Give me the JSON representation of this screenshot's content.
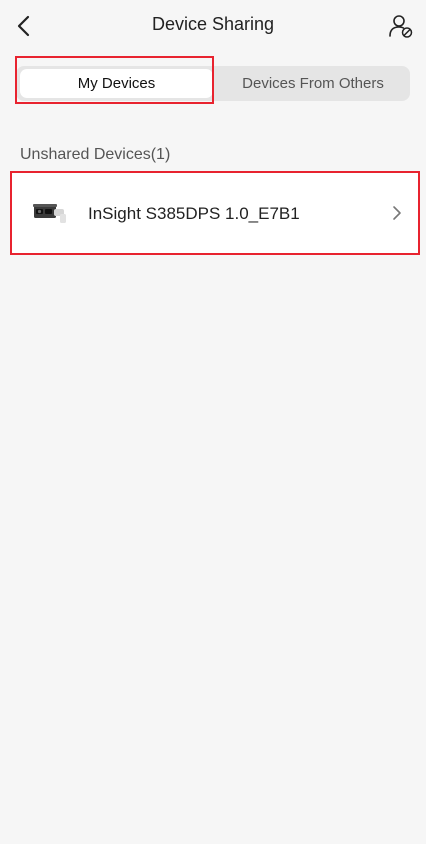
{
  "header": {
    "title": "Device Sharing",
    "back_icon": "chevron-left-icon",
    "user_icon": "user-share-settings-icon"
  },
  "tabs": [
    {
      "label": "My Devices",
      "active": true
    },
    {
      "label": "Devices From Others",
      "active": false
    }
  ],
  "section": {
    "title": "Unshared Devices(1)"
  },
  "devices": [
    {
      "name": "InSight S385DPS 1.0_E7B1",
      "icon": "camera-icon"
    }
  ],
  "colors": {
    "background": "#f6f6f6",
    "highlight": "#e8232f",
    "segment_bg": "#e5e5e5"
  }
}
